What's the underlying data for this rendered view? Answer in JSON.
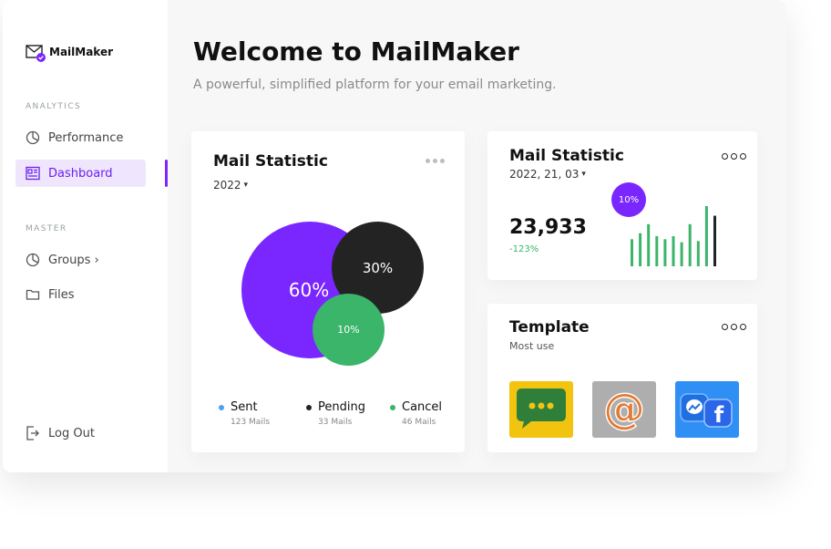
{
  "app": {
    "name": "MailMaker"
  },
  "sidebar": {
    "sections": [
      {
        "label": "ANALYTICS"
      },
      {
        "label": "MASTER"
      }
    ],
    "items": [
      {
        "label": "Performance",
        "icon": "pie-chart-icon"
      },
      {
        "label": "Dashboard",
        "icon": "dashboard-icon",
        "active": true
      },
      {
        "label": "Groups ›",
        "icon": "pie-chart-icon"
      },
      {
        "label": "Files",
        "icon": "folder-icon"
      }
    ],
    "logout": {
      "label": "Log Out",
      "icon": "logout-icon"
    }
  },
  "header": {
    "title": "Welcome to MailMaker",
    "subtitle": "A powerful, simplified platform for your email marketing."
  },
  "mail_stat_main": {
    "title": "Mail Statistic",
    "year": "2022",
    "bubbles": [
      {
        "label": "60%",
        "color": "#7a26ff"
      },
      {
        "label": "30%",
        "color": "#232323"
      },
      {
        "label": "10%",
        "color": "#3ab569"
      }
    ],
    "legend": [
      {
        "label": "Sent",
        "sub": "123 Mails",
        "color": "#4aa3f0"
      },
      {
        "label": "Pending",
        "sub": "33 Mails",
        "color": "#232323"
      },
      {
        "label": "Cancel",
        "sub": "46 Mails",
        "color": "#3ab569"
      }
    ]
  },
  "mail_stat_small": {
    "title": "Mail Statistic",
    "date": "2022, 21, 03",
    "value": "23,933",
    "change": "-123%",
    "badge": "10%",
    "bar_values": [
      0.45,
      0.55,
      0.7,
      0.5,
      0.45,
      0.5,
      0.4,
      0.7,
      0.42,
      1.0,
      0.84
    ],
    "colors": {
      "accent": "#7a26ff",
      "bar": "#3ab569",
      "last_bar": "#232323"
    }
  },
  "template": {
    "title": "Template",
    "subtitle": "Most use",
    "tiles": [
      {
        "name": "chat-bubble-thumbnail"
      },
      {
        "name": "at-sign-thumbnail"
      },
      {
        "name": "social-icons-thumbnail"
      }
    ]
  }
}
